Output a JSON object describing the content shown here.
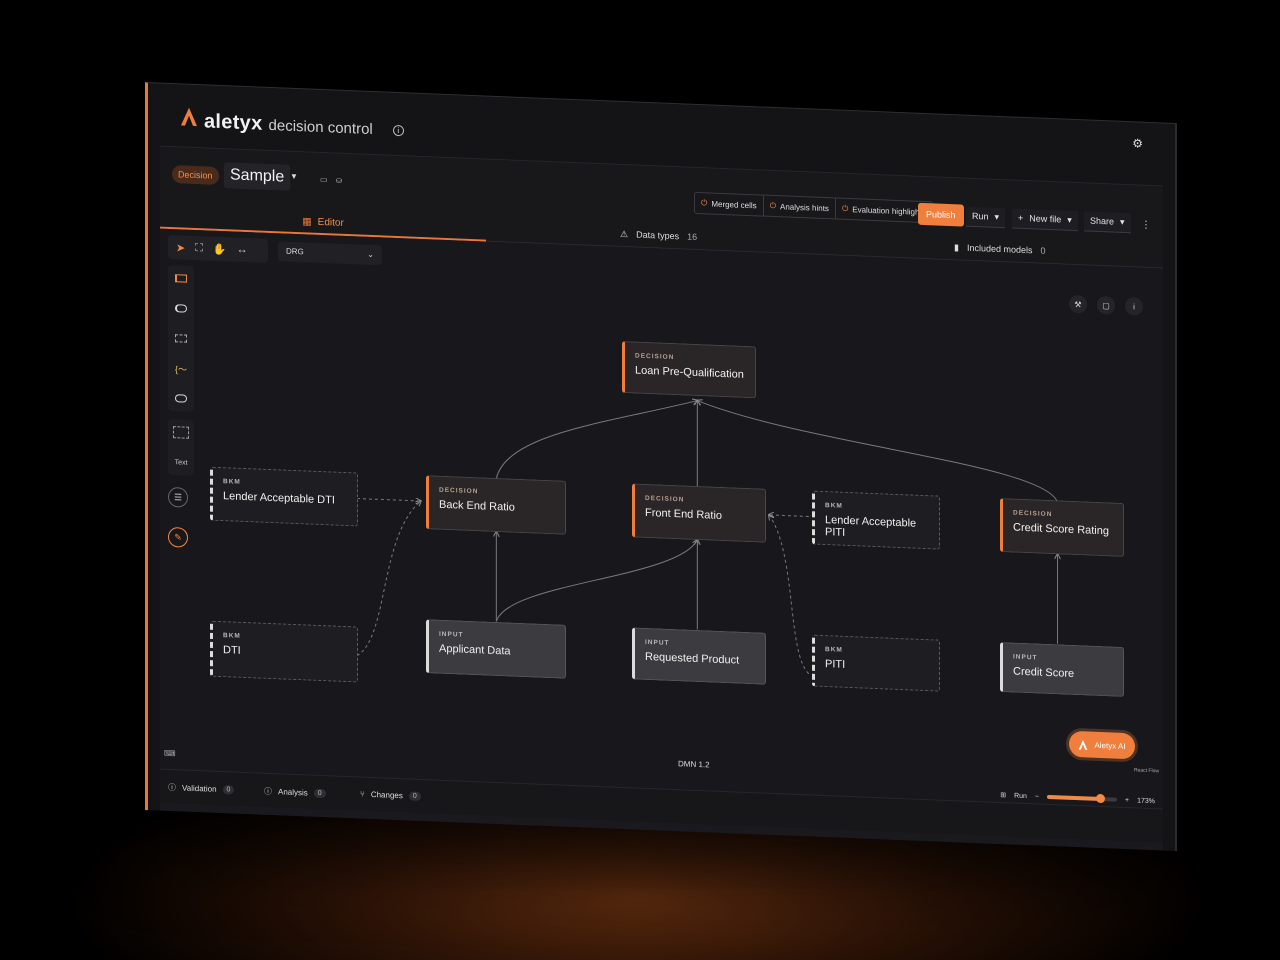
{
  "brand": {
    "name": "aletyx",
    "product": "decision control"
  },
  "header": {
    "badge": "Decision",
    "title": "Sample",
    "toggles": [
      {
        "label": "Merged cells"
      },
      {
        "label": "Analysis hints"
      },
      {
        "label": "Evaluation highlights"
      }
    ],
    "publish": "Publish",
    "run": "Run",
    "new_file": "New file",
    "share": "Share"
  },
  "tabs": {
    "editor": "Editor",
    "data_types": {
      "label": "Data types",
      "count": "16"
    },
    "included_models": {
      "label": "Included models",
      "count": "0"
    }
  },
  "canvas": {
    "view_select": "DRG",
    "palette_text": "Text",
    "nodes": [
      {
        "id": "n1",
        "kind": "DECISION",
        "name": "Loan Pre-Qualification"
      },
      {
        "id": "n2",
        "kind": "BKM",
        "name": "Lender Acceptable DTI"
      },
      {
        "id": "n3",
        "kind": "DECISION",
        "name": "Back End Ratio"
      },
      {
        "id": "n4",
        "kind": "DECISION",
        "name": "Front End Ratio"
      },
      {
        "id": "n5",
        "kind": "BKM",
        "name": "Lender Acceptable PITI"
      },
      {
        "id": "n6",
        "kind": "DECISION",
        "name": "Credit Score Rating"
      },
      {
        "id": "n7",
        "kind": "BKM",
        "name": "DTI"
      },
      {
        "id": "n8",
        "kind": "INPUT",
        "name": "Applicant Data"
      },
      {
        "id": "n9",
        "kind": "INPUT",
        "name": "Requested Product"
      },
      {
        "id": "n10",
        "kind": "BKM",
        "name": "PITI"
      },
      {
        "id": "n11",
        "kind": "INPUT",
        "name": "Credit Score"
      }
    ],
    "ai_button": "Aletyx AI",
    "dmn_version": "DMN 1.2",
    "react_flow": "React Flow"
  },
  "status": {
    "validation": {
      "label": "Validation",
      "count": "0"
    },
    "analysis": {
      "label": "Analysis",
      "count": "0"
    },
    "changes": {
      "label": "Changes",
      "count": "0"
    },
    "run": "Run",
    "zoom": "173%",
    "zoom_fraction": 0.75
  },
  "colors": {
    "accent": "#f07e3d",
    "background": "#18181c"
  }
}
